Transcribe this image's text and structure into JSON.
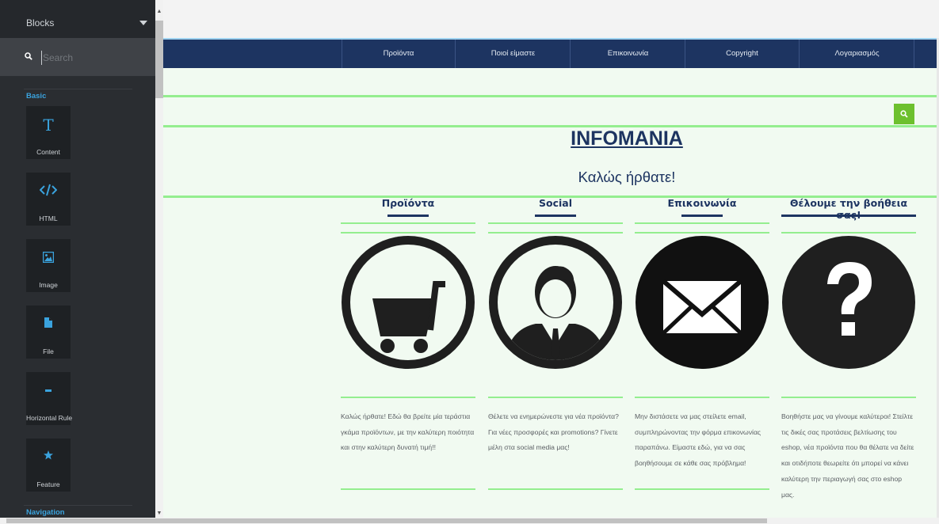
{
  "sidebar": {
    "title": "Blocks",
    "search_placeholder": "Search",
    "categories": [
      {
        "label": "Basic"
      },
      {
        "label": "Navigation"
      }
    ],
    "blocks": [
      {
        "label": "Content",
        "icon": "text-icon"
      },
      {
        "label": "HTML",
        "icon": "code-icon"
      },
      {
        "label": "Image",
        "icon": "image-icon"
      },
      {
        "label": "File",
        "icon": "file-icon"
      },
      {
        "label": "Horizontal Rule",
        "icon": "minus-icon"
      },
      {
        "label": "Feature",
        "icon": "star-icon"
      }
    ]
  },
  "site": {
    "nav": [
      {
        "label": "Προϊόντα"
      },
      {
        "label": "Ποιοί είμαστε"
      },
      {
        "label": "Επικοινωνία"
      },
      {
        "label": "Copyright"
      },
      {
        "label": "Λογαριασμός"
      }
    ],
    "title": "INFOMANIA",
    "welcome": "Καλώς ήρθατε!",
    "columns": [
      {
        "title": "Προϊόντα",
        "icon": "shopping-cart-icon",
        "text": "Καλώς ήρθατε! Εδώ θα βρείτε μία τεράστια γκάμα προϊόντων, με την καλύτερη ποιότητα και στην καλύτερη δυνατή τιμή!!"
      },
      {
        "title": "Social",
        "icon": "user-icon",
        "text": "Θέλετε να ενημερώνεστε για νέα προϊόντα? Για νέες προσφορές και promotions? Γίνετε μέλη στα social media μας!"
      },
      {
        "title": "Επικοινωνία",
        "icon": "envelope-icon",
        "text": "Μην διστάσετε να μας στείλετε email, συμπληρώνοντας την φόρμα επικονωνίας παραπάνω. Είμαστε εδώ, για να σας βοηθήσουμε σε κάθε σας πρόβλημα!"
      },
      {
        "title": "Θέλουμε την βοήθεια σας!",
        "icon": "question-mark-icon",
        "text": "Βοηθήστε μας να γίνουμε καλύτεροι! Στείλτε τις δικές σας προτάσεις βελτίωσης του eshop, νέα προϊόντα που θα θέλατε να δείτε και οτιδήποτε θεωρείτε ότι μπορεί να κάνει καλύτερη την περιαγωγή σας στο eshop μας."
      }
    ]
  },
  "colors": {
    "navy": "#1d3461",
    "green_rule": "#94ee8f",
    "search_green": "#6dc02e",
    "sidebar_bg": "#2a2d31",
    "accent_blue": "#3aa3de"
  }
}
